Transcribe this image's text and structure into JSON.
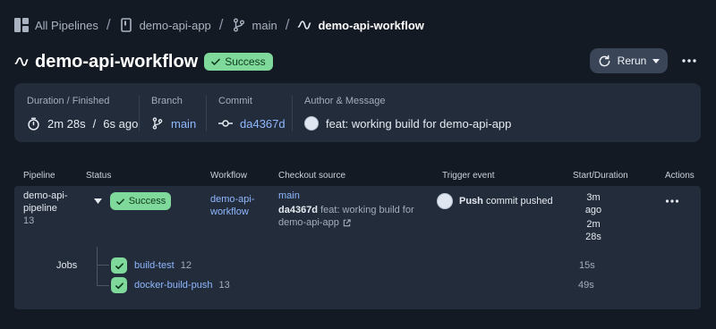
{
  "breadcrumb": {
    "all_pipelines": "All Pipelines",
    "project": "demo-api-app",
    "branch": "main",
    "workflow": "demo-api-workflow",
    "separator": "/"
  },
  "header": {
    "title": "demo-api-workflow",
    "status": "Success",
    "rerun_label": "Rerun"
  },
  "summary": {
    "duration_label": "Duration / Finished",
    "duration_value": "2m 28s",
    "duration_sep": "/",
    "finished_value": "6s ago",
    "branch_label": "Branch",
    "branch_value": "main",
    "commit_label": "Commit",
    "commit_value": "da4367d",
    "author_label": "Author & Message",
    "message_value": "feat: working build for demo-api-app"
  },
  "table": {
    "headers": {
      "pipeline": "Pipeline",
      "status": "Status",
      "workflow": "Workflow",
      "checkout": "Checkout source",
      "trigger": "Trigger event",
      "start": "Start/Duration",
      "actions": "Actions"
    },
    "row": {
      "pipeline_line1": "demo-api-",
      "pipeline_line2": "pipeline",
      "pipeline_number": "13",
      "status": "Success",
      "workflow_line1": "demo-api-",
      "workflow_line2": "workflow",
      "checkout_branch": "main",
      "checkout_commit": "da4367d",
      "checkout_msg_line1": "feat: working build for",
      "checkout_msg_line2": "demo-api-app",
      "trigger_type": "Push",
      "trigger_text": "commit pushed",
      "start_line1": "3m",
      "start_line2": "ago",
      "duration_line1": "2m",
      "duration_line2": "28s"
    },
    "jobs_label": "Jobs",
    "jobs": [
      {
        "name": "build-test",
        "number": "12",
        "duration": "15s"
      },
      {
        "name": "docker-build-push",
        "number": "13",
        "duration": "49s"
      }
    ]
  },
  "colors": {
    "background": "#141a24",
    "panel": "#232c3b",
    "success": "#7fd99a",
    "link": "#8fb8ff"
  }
}
